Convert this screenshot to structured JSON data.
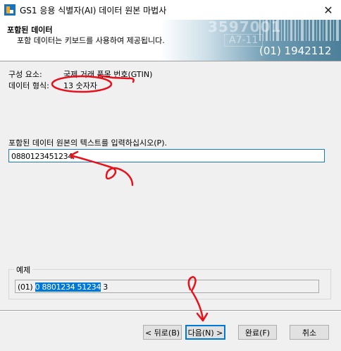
{
  "window": {
    "title": "GS1 응용 식별자(AI) 데이터 원본 마법사",
    "close_glyph": "✕"
  },
  "banner": {
    "heading": "포함된 데이터",
    "subtitle": "포함 데이터는 키보드를 사용하여 제공됩니다.",
    "barcode_text_1": "3597001",
    "barcode_text_2": "A7-11",
    "barcode_number": "(01) 1942112"
  },
  "fields": {
    "component_label": "구성 요소:",
    "component_value": "국제 거래 품목 번호(GTIN)",
    "format_label": "데이터 형식:",
    "format_value": "13 숫자자"
  },
  "input": {
    "label": "포함된 데이터 원본의 텍스트를 입력하십시오(P).",
    "value": "0880123451234"
  },
  "example": {
    "legend": "예제",
    "prefix": "(01) ",
    "highlighted": "0 8801234 51234",
    "suffix": " 3"
  },
  "buttons": {
    "back": "< 뒤로(B)",
    "next": "다음(N) >",
    "finish": "완료(F)",
    "cancel": "취소"
  },
  "colors": {
    "accent": "#0078d7",
    "annotation": "#e8101a"
  }
}
